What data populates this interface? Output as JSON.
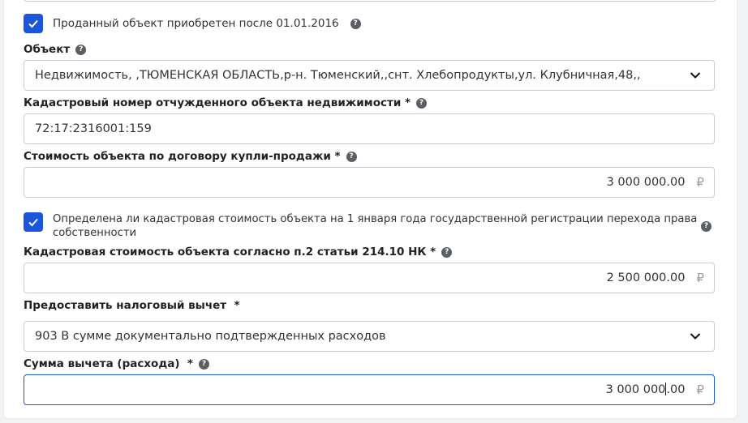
{
  "sold_after_checkbox": {
    "checked": true,
    "label": "Проданный объект приобретен после 01.01.2016"
  },
  "object": {
    "label": "Объект",
    "value": "Недвижимость, ,ТЮМЕНСКАЯ ОБЛАСТЬ,р-н. Тюменский,,снт. Хлебопродукты,ул. Клубничная,48,,"
  },
  "cadastral_number": {
    "label": "Кадастровый номер отчужденного объекта недвижимости *",
    "value": "72:17:2316001:159"
  },
  "contract_price": {
    "label": "Стоимость объекта по договору купли-продажи *",
    "value": "3 000 000.00",
    "currency": "₽"
  },
  "cadastral_defined_checkbox": {
    "checked": true,
    "label_line1": "Определена ли кадастровая стоимость объекта на 1 января года государственной регистрации перехода права",
    "label_line2": "собственности"
  },
  "cadastral_value": {
    "label": "Кадастровая стоимость объекта согласно п.2 статьи 214.10 НК *",
    "value": "2 500 000.00",
    "currency": "₽"
  },
  "deduction_type": {
    "label": "Предоставить налоговый вычет  *",
    "value": "903 В сумме документально подтвержденных расходов"
  },
  "deduction_amount": {
    "label": "Сумма вычета (расхода)  *",
    "value_before_caret": "3 000 000",
    "value_after_caret": ".00",
    "currency": "₽"
  },
  "help_glyph": "?",
  "colors": {
    "accent": "#1a56db",
    "border": "#c9cdd3",
    "help_icon": "#5b5e63"
  }
}
